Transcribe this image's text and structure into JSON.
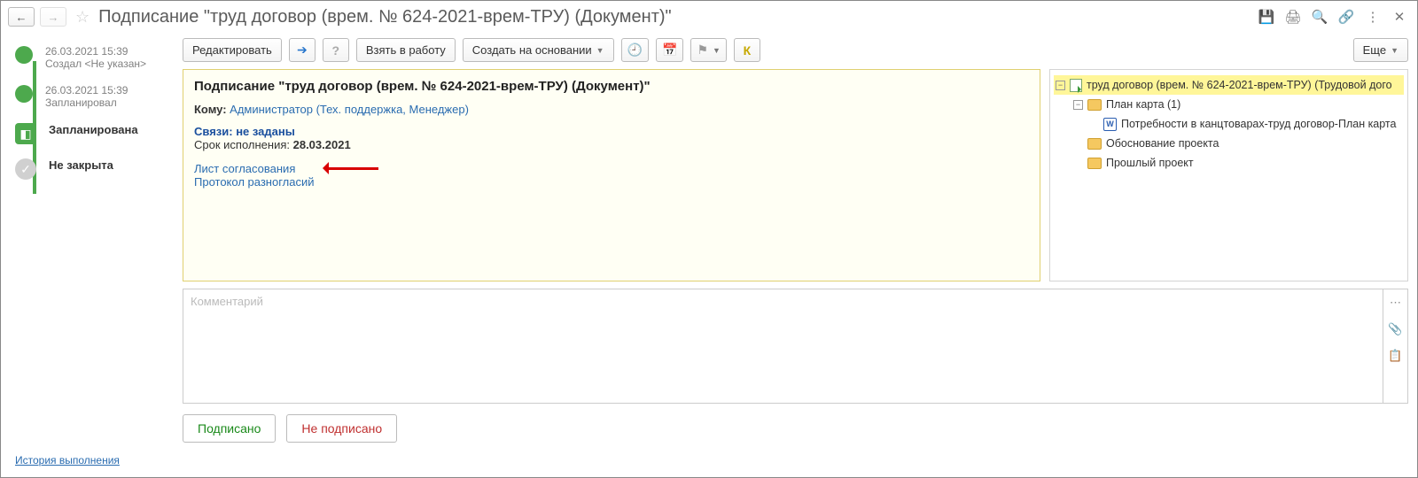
{
  "header": {
    "title": "Подписание \"труд договор (врем. № 624-2021-врем-ТРУ) (Документ)\""
  },
  "timeline": [
    {
      "date": "26.03.2021 15:39",
      "label": "Создал <Не указан>"
    },
    {
      "date": "26.03.2021 15:39",
      "label": "Запланировал"
    },
    {
      "label": "Запланирована"
    },
    {
      "label": "Не закрыта"
    }
  ],
  "history_link": "История выполнения",
  "toolbar": {
    "edit": "Редактировать",
    "take": "Взять в работу",
    "create_based": "Создать на основании",
    "more": "Еще",
    "k": "К"
  },
  "info": {
    "heading": "Подписание \"труд договор (врем. № 624-2021-врем-ТРУ) (Документ)\"",
    "to_label": "Кому:",
    "to_value": "Администратор (Тех. поддержка, Менеджер)",
    "links_label": "Связи: не заданы",
    "due_label": "Срок исполнения:",
    "due_value": "28.03.2021",
    "link1": "Лист согласования",
    "link2": "Протокол разногласий"
  },
  "tree": {
    "root": "труд договор (врем. № 624-2021-врем-ТРУ) (Трудовой дого",
    "n1": "План карта (1)",
    "n1_1": "Потребности в канцтоварах-труд договор-План карта",
    "n2": "Обоснование проекта",
    "n3": "Прошлый проект"
  },
  "comment_placeholder": "Комментарий",
  "actions": {
    "ok": "Подписано",
    "no": "Не подписано"
  }
}
